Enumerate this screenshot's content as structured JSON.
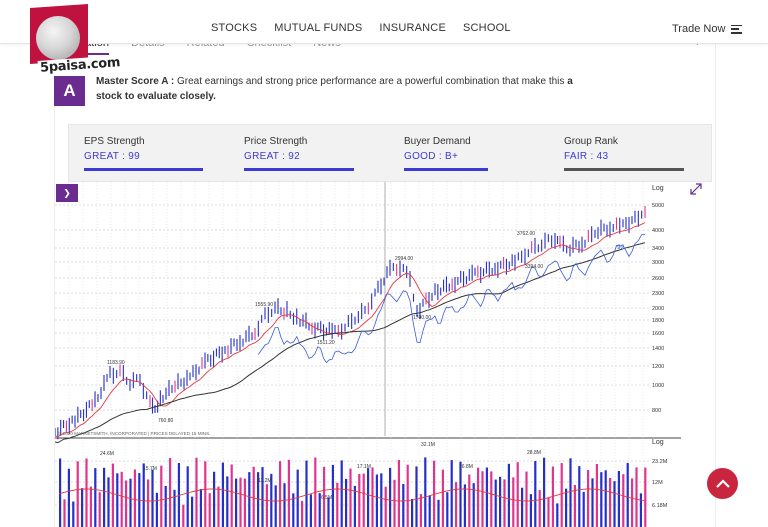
{
  "brand": {
    "name": "5paisa.com"
  },
  "nav": {
    "items": [
      "STOCKS",
      "MUTUAL FUNDS",
      "INSURANCE",
      "SCHOOL"
    ],
    "trade_label": "Trade Now"
  },
  "tabs": {
    "items": [
      "...ation",
      "Details",
      "Related",
      "Checklist",
      "News"
    ]
  },
  "score": {
    "grade": "A",
    "prefix": "Master Score A :",
    "text": "Great earnings and strong price performance are a powerful combination that make this",
    "bold_tail": "a",
    "line2": "stock to evaluate closely."
  },
  "metrics": [
    {
      "label": "EPS Strength",
      "value": "GREAT : 99",
      "level": 0.99,
      "color": "#3b3bd3"
    },
    {
      "label": "Price Strength",
      "value": "GREAT : 92",
      "level": 0.92,
      "color": "#3b3bd3"
    },
    {
      "label": "Buyer Demand",
      "value": "GOOD : B+",
      "level": 0.7,
      "color": "#3b3bd3"
    },
    {
      "label": "Group Rank",
      "value": "FAIR : 43",
      "level": 1.0,
      "color": "#555555"
    }
  ],
  "chart_data": [
    {
      "type": "line",
      "scale": "log",
      "scale_label": "Log",
      "y_ticks": [
        "5000",
        "4000",
        "3400",
        "3000",
        "2600",
        "2300",
        "2000",
        "1800",
        "1600",
        "1400",
        "1200",
        "1000",
        "800"
      ],
      "annotations": [
        "1183.90",
        "760.80",
        "1555.90",
        "1511.20",
        "2994.00",
        "1700.00",
        "3762.00",
        "3394.00"
      ],
      "rs_label": "92",
      "footer": "© 2020 MARKETSMITH, INCORPORATED | PRICES DELAYED 15 MINS.",
      "colors": {
        "price": "#2430c8",
        "short_ma": "#e23a3a",
        "long_ma": "#333333",
        "rs_line": "#3b5bdb"
      }
    },
    {
      "type": "bar",
      "scale": "log",
      "scale_label": "Log",
      "y_ticks": [
        "23.2M",
        "12M",
        "6.18M"
      ],
      "annotations": [
        "24.6M",
        "15.7M",
        "11.2M",
        "6.5M",
        "17.1M",
        "32.1M",
        "16.8M",
        "28.8M"
      ],
      "colors": {
        "up": "#2430c8",
        "down": "#e0358f",
        "avg": "#e23a3a"
      }
    }
  ]
}
